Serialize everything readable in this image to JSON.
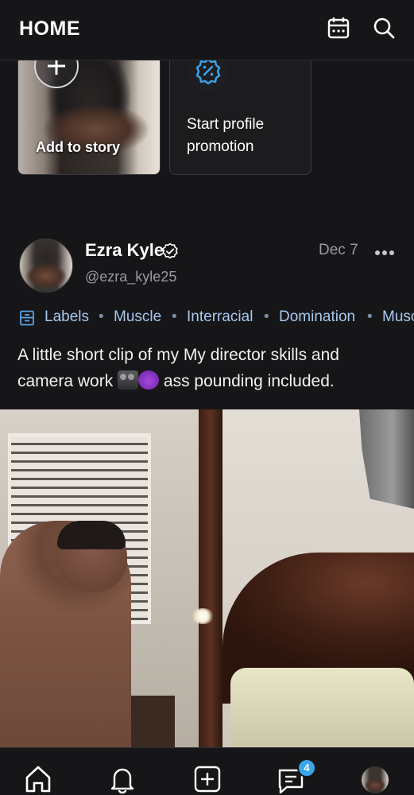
{
  "header": {
    "title": "HOME",
    "calendar_icon": "calendar-icon",
    "search_icon": "search-icon"
  },
  "stories": {
    "add_label": "Add to story",
    "promo_label": "Start profile promotion"
  },
  "post": {
    "author_name": "Ezra Kyle",
    "handle": "@ezra_kyle25",
    "date": "Dec 7",
    "labels": [
      "Labels",
      "Muscle",
      "Interracial",
      "Domination",
      "Musc"
    ],
    "text_part1": "A little short clip of my My director skills and camera work",
    "text_part2": "ass pounding included.",
    "emojis": [
      "movie-camera",
      "smiling-devil"
    ]
  },
  "nav": {
    "items": [
      "home-icon",
      "notifications-icon",
      "add-post-icon",
      "messages-icon",
      "profile-avatar"
    ],
    "messages_badge": "4"
  },
  "colors": {
    "background": "#161618",
    "accent": "#3aa5e9",
    "label_text": "#a7c8ee",
    "muted_text": "#9a9aa0"
  }
}
